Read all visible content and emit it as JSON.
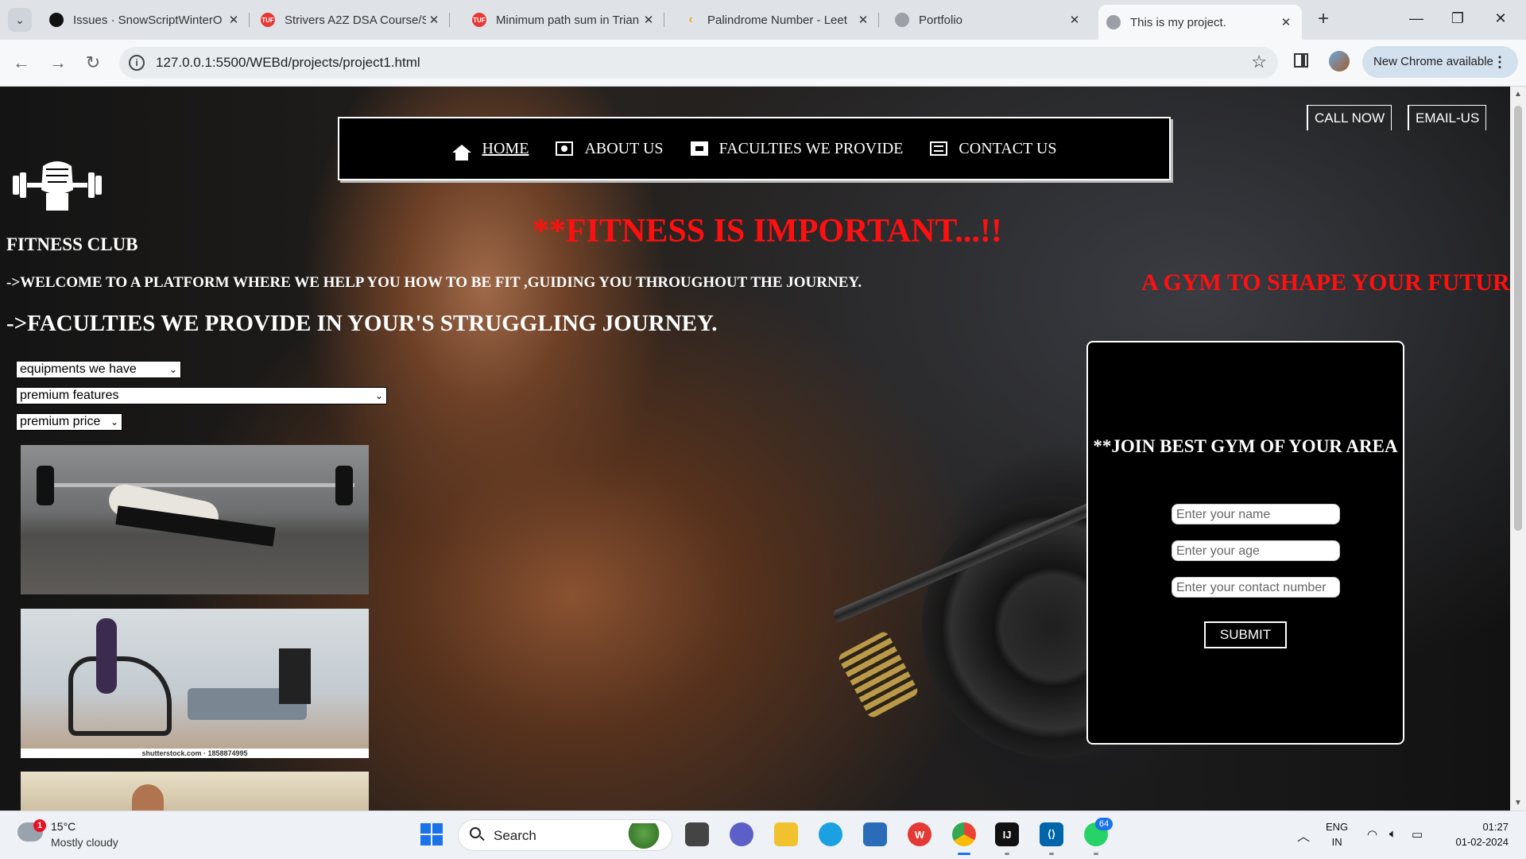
{
  "browser": {
    "tabs": [
      {
        "title": "Issues · SnowScriptWinterO",
        "favicon": "github-icon",
        "color": "#111111"
      },
      {
        "title": "Strivers A2Z DSA Course/S",
        "favicon": "tuf-icon",
        "color": "#e53935"
      },
      {
        "title": "Minimum path sum in Trian",
        "favicon": "tuf-icon",
        "color": "#e53935"
      },
      {
        "title": "Palindrome Number - Leet",
        "favicon": "leetcode-icon",
        "color": "#f5a623"
      },
      {
        "title": "Portfolio",
        "favicon": "globe-icon",
        "color": "#5f6368"
      },
      {
        "title": "This is my project.",
        "favicon": "globe-icon",
        "color": "#5f6368",
        "active": true
      }
    ],
    "url": "127.0.0.1:5500/WEBd/projects/project1.html",
    "update_label": "New Chrome available"
  },
  "page": {
    "nav": [
      {
        "label": "HOME",
        "icon": "home-icon",
        "current": true
      },
      {
        "label": "ABOUT US",
        "icon": "camera-icon"
      },
      {
        "label": "FACULTIES WE PROVIDE",
        "icon": "building-icon"
      },
      {
        "label": "CONTACT US",
        "icon": "phone-icon"
      }
    ],
    "call_now": "CALL NOW",
    "email_us": "EMAIL-US",
    "club_title": "FITNESS CLUB",
    "tagline": "**FITNESS IS IMPORTANT...!!",
    "welcome": "->WELCOME TO A PLATFORM WHERE WE HELP YOU HOW TO BE FIT ,GUIDING YOU THROUGHOUT THE JOURNEY.",
    "shape_future": "A GYM TO SHAPE YOUR FUTURE",
    "faculties_heading": "->FACULTIES WE PROVIDE IN YOUR'S STRUGGLING JOURNEY.",
    "selects": {
      "equipments": "equipments we have",
      "features": "premium features",
      "price": "premium price"
    },
    "photo_caption": "shutterstock.com · 1858874995",
    "join": {
      "title": "**JOIN BEST GYM OF YOUR AREA",
      "name_placeholder": "Enter your name",
      "age_placeholder": "Enter your age",
      "contact_placeholder": "Enter your contact number",
      "submit": "SUBMIT"
    },
    "accent_color": "#ff1010"
  },
  "taskbar": {
    "weather_temp": "15°C",
    "weather_cond": "Mostly cloudy",
    "weather_badge": "1",
    "search_label": "Search",
    "whatsapp_badge": "64",
    "lang_top": "ENG",
    "lang_bottom": "IN",
    "time": "01:27",
    "date": "01-02-2024"
  }
}
